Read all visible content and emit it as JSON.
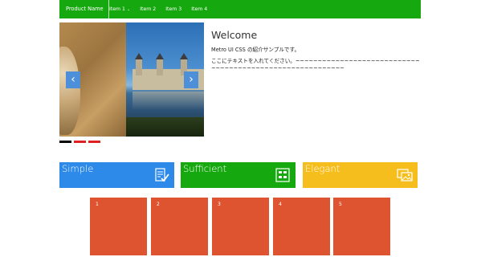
{
  "navbar": {
    "brand": "Product Name",
    "items": [
      {
        "label": "Item 1",
        "has_dropdown": true
      },
      {
        "label": "Item 2"
      },
      {
        "label": "Item 3"
      },
      {
        "label": "Item 4"
      }
    ],
    "color": "#16a80f"
  },
  "slider": {
    "prev_label": "‹",
    "next_label": "›",
    "dots": [
      "active",
      "inactive",
      "inactive"
    ]
  },
  "welcome": {
    "title": "Welcome",
    "subtitle": "Metro UI CSS の紹介サンプルです。",
    "body": "ここにテキストを入れてください。~~~~~~~~~~~~~~~~~~~~~~~~~~~~~~~~~~~~~~~~~~~~~~~~~~~~~~~~~~"
  },
  "tiles": [
    {
      "label": "Simple",
      "icon": "form-check-icon",
      "color": "#2d8ae8"
    },
    {
      "label": "Sufficient",
      "icon": "grid-layout-icon",
      "color": "#16a80f"
    },
    {
      "label": "Elegant",
      "icon": "images-icon",
      "color": "#f6be1c"
    }
  ],
  "boxes": [
    "1",
    "2",
    "3",
    "4",
    "5"
  ],
  "box_color": "#de5430"
}
